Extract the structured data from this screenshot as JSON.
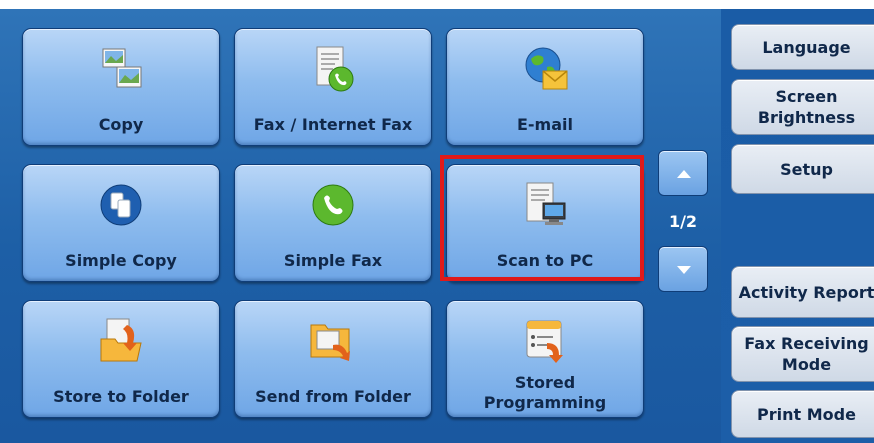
{
  "tiles": [
    {
      "label": "Copy",
      "icon": "copy-icon"
    },
    {
      "label": "Fax / Internet Fax",
      "icon": "fax-document-icon"
    },
    {
      "label": "E-mail",
      "icon": "email-globe-icon"
    },
    {
      "label": "Simple Copy",
      "icon": "simple-copy-icon"
    },
    {
      "label": "Simple Fax",
      "icon": "phone-icon"
    },
    {
      "label": "Scan to PC",
      "icon": "scan-to-pc-icon"
    },
    {
      "label": "Store to Folder",
      "icon": "store-folder-icon"
    },
    {
      "label": "Send from Folder",
      "icon": "send-folder-icon"
    },
    {
      "label_line1": "Stored",
      "label_line2": "Programming",
      "icon": "stored-programming-icon"
    }
  ],
  "pager": {
    "indicator": "1/2",
    "up_icon": "arrow-up-icon",
    "down_icon": "arrow-down-icon"
  },
  "side": {
    "language": "Language",
    "brightness_line1": "Screen",
    "brightness_line2": "Brightness",
    "setup": "Setup",
    "activity_report": "Activity Report",
    "fax_mode_line1": "Fax Receiving",
    "fax_mode_line2": "Mode",
    "print_mode": "Print Mode"
  },
  "colors": {
    "panel": "#1d5fa6",
    "highlight": "#e01a1a",
    "tile": "#8ebcee"
  }
}
